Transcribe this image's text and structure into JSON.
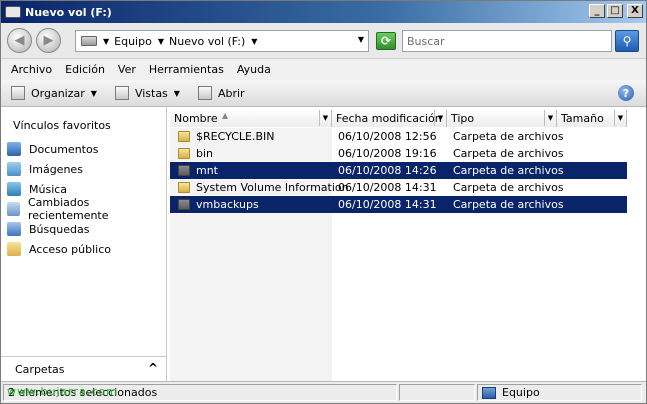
{
  "window": {
    "title": "Nuevo vol (F:)",
    "controls": [
      "_",
      "□",
      "X"
    ]
  },
  "address": {
    "crumbs": [
      "Equipo",
      "Nuevo vol (F:)"
    ],
    "search_placeholder": "Buscar"
  },
  "menu": {
    "items": [
      "Archivo",
      "Edición",
      "Ver",
      "Herramientas",
      "Ayuda"
    ]
  },
  "toolbar": {
    "organize_label": "Organizar",
    "views_label": "Vistas",
    "open_label": "Abrir",
    "help": "?"
  },
  "nav": {
    "favorites_title": "Vínculos favoritos",
    "items": [
      {
        "label": "Documentos",
        "icon": "documents-icon"
      },
      {
        "label": "Imágenes",
        "icon": "pictures-icon"
      },
      {
        "label": "Música",
        "icon": "music-icon"
      },
      {
        "label": "Cambiados recientemente",
        "icon": "recent-icon"
      },
      {
        "label": "Búsquedas",
        "icon": "searches-icon"
      },
      {
        "label": "Acceso público",
        "icon": "public-folder-icon"
      }
    ],
    "folders_label": "Carpetas"
  },
  "columns": [
    "Nombre",
    "Fecha modificación",
    "Tipo",
    "Tamaño"
  ],
  "files": [
    {
      "name": "$RECYCLE.BIN",
      "date": "06/10/2008 12:56",
      "type": "Carpeta de archivos",
      "size": "",
      "selected": false,
      "icon": "folder-icon"
    },
    {
      "name": "bin",
      "date": "06/10/2008 19:16",
      "type": "Carpeta de archivos",
      "size": "",
      "selected": false,
      "icon": "folder-icon"
    },
    {
      "name": "mnt",
      "date": "06/10/2008 14:26",
      "type": "Carpeta de archivos",
      "size": "",
      "selected": true,
      "icon": "folder-icon"
    },
    {
      "name": "System Volume Information",
      "date": "06/10/2008 14:31",
      "type": "Carpeta de archivos",
      "size": "",
      "selected": false,
      "icon": "folder-icon"
    },
    {
      "name": "vmbackups",
      "date": "06/10/2008 14:31",
      "type": "Carpeta de archivos",
      "size": "",
      "selected": true,
      "icon": "folder-icon"
    }
  ],
  "status": {
    "selection": "2 elementos seleccionados",
    "location": "Equipo",
    "watermark": "www.bujarra.com"
  },
  "colors": {
    "selection": "#0a246a",
    "titlebar_start": "#0a246a",
    "watermark": "#2bb52b"
  }
}
